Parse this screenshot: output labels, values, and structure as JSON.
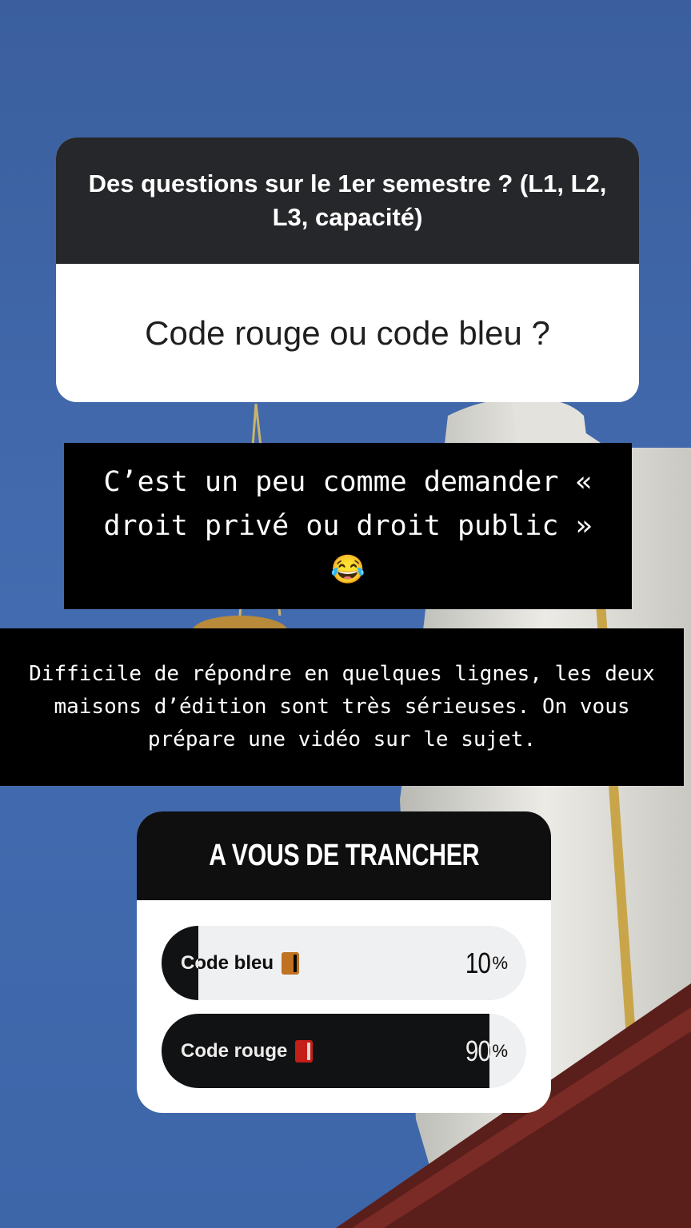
{
  "question": {
    "prompt": "Des questions sur le 1er semestre ? (L1, L2, L3, capacité)",
    "answer": "Code rouge ou code bleu ?"
  },
  "caption_1": "C’est un peu comme demander « droit privé ou droit public » 😂",
  "caption_2": "Difficile de répondre en quelques lignes, les deux maisons d’édition sont très sérieuses. On vous prépare une vidéo sur le sujet.",
  "poll": {
    "title": "A VOUS DE TRANCHER",
    "options": [
      {
        "label": "Code bleu",
        "icon": "blue-book-icon",
        "icon_color": "#2f7fd1",
        "percent": "10",
        "percent_symbol": "%",
        "fraction": 0.1
      },
      {
        "label": "Code rouge",
        "icon": "red-book-icon",
        "icon_color": "#d5302d",
        "percent": "90",
        "percent_symbol": "%",
        "fraction": 0.9
      }
    ]
  }
}
